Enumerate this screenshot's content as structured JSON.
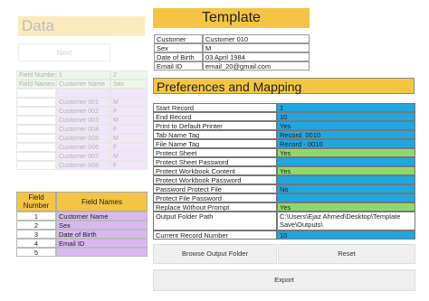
{
  "background": {
    "data_title": "Data",
    "next_button": "Next",
    "faint_rows": [
      {
        "a": "Field Number",
        "b": "1",
        "c": "2"
      },
      {
        "a": "Field Names",
        "b": "Customer Name",
        "c": "Sex"
      },
      {
        "a": "",
        "b": "",
        "c": ""
      },
      {
        "a": "",
        "b": "Customer 001",
        "c": "M"
      },
      {
        "a": "",
        "b": "Customer 002",
        "c": "F"
      },
      {
        "a": "",
        "b": "Customer 003",
        "c": "M"
      },
      {
        "a": "",
        "b": "Customer 004",
        "c": "F"
      },
      {
        "a": "",
        "b": "Customer 005",
        "c": "M"
      },
      {
        "a": "",
        "b": "Customer 006",
        "c": "F"
      },
      {
        "a": "",
        "b": "Customer 007",
        "c": "M"
      },
      {
        "a": "",
        "b": "Customer 008",
        "c": "F"
      }
    ],
    "field_table": {
      "headers": [
        "Field Number",
        "Field Names"
      ],
      "rows": [
        {
          "num": "1",
          "name": "Customer Name"
        },
        {
          "num": "2",
          "name": "Sex"
        },
        {
          "num": "3",
          "name": "Date of Birth"
        },
        {
          "num": "4",
          "name": "Email ID"
        },
        {
          "num": "5",
          "name": ""
        }
      ]
    }
  },
  "template": {
    "title": "Template",
    "fields": [
      {
        "key": "Customer Name",
        "value": "Customer 010"
      },
      {
        "key": "Sex",
        "value": "M"
      },
      {
        "key": "Date of Birth",
        "value": "03 April 1984"
      },
      {
        "key": "Email ID",
        "value": "email_20@gmail.com"
      }
    ]
  },
  "preferences": {
    "title": "Preferences and Mapping",
    "rows": [
      {
        "key": "Start Record",
        "value": "1",
        "color": "blue"
      },
      {
        "key": "End Record",
        "value": "10",
        "color": "blue"
      },
      {
        "key": "Print to Default Printer",
        "value": "Yes",
        "color": "blue"
      },
      {
        "key": "Tab Name Tag",
        "value": "Record_0010",
        "color": "blue"
      },
      {
        "key": "File Name Tag",
        "value": "Record - 0010",
        "color": "blue"
      },
      {
        "key": "Protect Sheet",
        "value": "Yes",
        "color": "green"
      },
      {
        "key": "Protect Sheet Password",
        "value": "",
        "color": "blue"
      },
      {
        "key": "Protect Workbook Content",
        "value": "Yes",
        "color": "green"
      },
      {
        "key": "Protect Workbook Password",
        "value": "",
        "color": "blue"
      },
      {
        "key": "Password Protect File",
        "value": "No",
        "color": "blue"
      },
      {
        "key": "Protect File Password",
        "value": "",
        "color": "blue"
      },
      {
        "key": "Replace Without Prompt",
        "value": "Yes",
        "color": "green"
      },
      {
        "key": "Output Folder Path",
        "value": "C:\\Users\\Ejaz Ahmed\\Desktop\\Template Save\\Outputs\\",
        "color": "white",
        "tall": true
      },
      {
        "key": "Current Record Number",
        "value": "10",
        "color": "blue"
      }
    ]
  },
  "buttons": {
    "browse": "Browse Output Folder",
    "reset": "Reset",
    "export": "Export"
  }
}
